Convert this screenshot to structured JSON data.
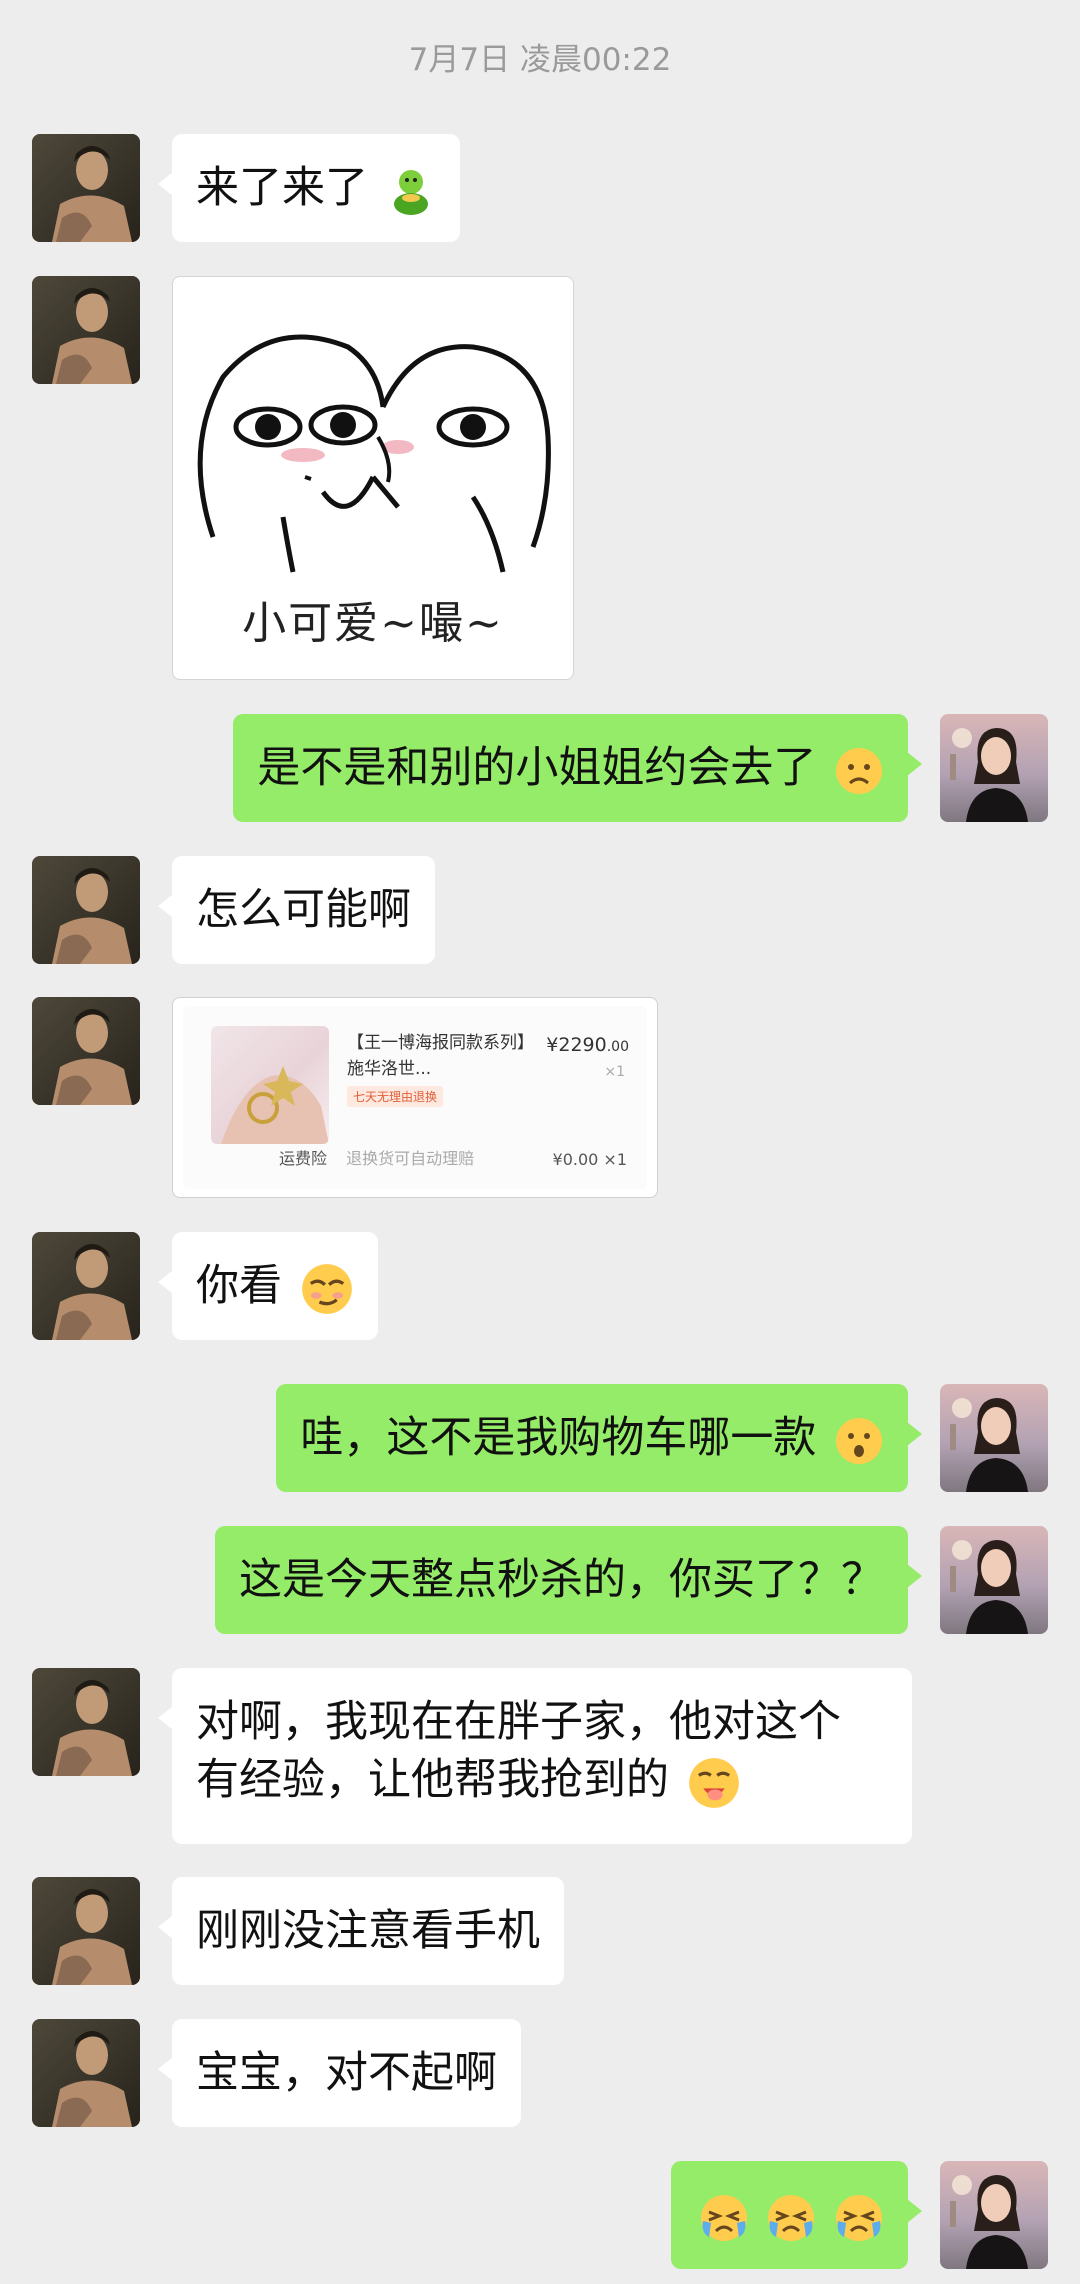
{
  "timestamp": "7月7日 凌晨00:22",
  "messages": {
    "m1": {
      "text": "来了来了",
      "emoji": "green-person-emoji"
    },
    "m2": {
      "sticker_caption": "小可爱~嘬~"
    },
    "m3": {
      "text": "是不是和别的小姐姐约会去了",
      "emoji": "frowning-face-emoji"
    },
    "m4": {
      "text": "怎么可能啊"
    },
    "m5": {
      "product_title": "【王一博海报同款系列】",
      "product_subtitle": "施华洛世...",
      "product_price": "¥2290",
      "product_price_cents": ".00",
      "product_qty": "×1",
      "product_tag": "七天无理由退换",
      "footer_label": "运费险",
      "footer_note": "退换货可自动理赔",
      "footer_total": "¥0.00 ×1"
    },
    "m6": {
      "text": "你看",
      "emoji": "smirk-face-emoji"
    },
    "m7": {
      "text": "哇，这不是我购物车哪一款",
      "emoji": "surprised-face-emoji"
    },
    "m8": {
      "text": "这是今天整点秒杀的，你买了？？"
    },
    "m9": {
      "line1": "对啊，我现在在胖子家，他对这个",
      "line2": "有经验，让他帮我抢到的",
      "emoji": "drooling-face-emoji"
    },
    "m10": {
      "text": "刚刚没注意看手机"
    },
    "m11": {
      "text": "宝宝，对不起啊"
    },
    "m12": {
      "emojis": [
        "crying-face-emoji",
        "crying-face-emoji",
        "crying-face-emoji"
      ]
    }
  },
  "colors": {
    "background": "#ededed",
    "incoming_bubble": "#ffffff",
    "outgoing_bubble": "#95ec69",
    "timestamp_text": "#9a9a9a"
  }
}
